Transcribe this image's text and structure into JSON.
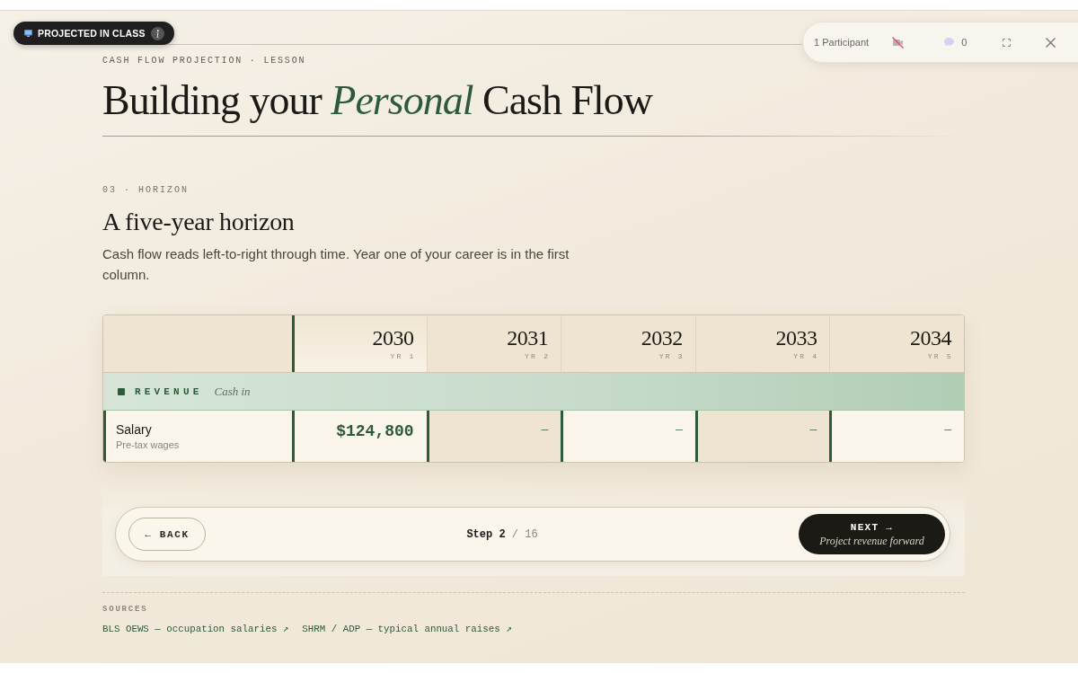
{
  "presentation_badge": {
    "label": "PROJECTED IN CLASS"
  },
  "call_bar": {
    "participants": "1 Participant",
    "video_muted": true,
    "chat_count": "0"
  },
  "lesson": {
    "eyebrow": "CASH FLOW PROJECTION · LESSON",
    "title": "Building your *Personal* Cash Flow"
  },
  "section": {
    "eyebrow": "03 · HORIZON",
    "heading": "A five-year horizon",
    "body": "Cash flow reads left-to-right through time. Year one of your career is in the first column."
  },
  "table": {
    "years": [
      {
        "year": "2030",
        "label": "YR 1",
        "current": true
      },
      {
        "year": "2031",
        "label": "YR 2",
        "current": false
      },
      {
        "year": "2032",
        "label": "YR 3",
        "current": false
      },
      {
        "year": "2033",
        "label": "YR 4",
        "current": false
      },
      {
        "year": "2034",
        "label": "YR 5",
        "current": false
      }
    ],
    "groups": [
      {
        "name": "REVENUE",
        "note": "Cash in",
        "rows": [
          {
            "label": "Salary",
            "sublabel": "Pre-tax wages",
            "cells": [
              {
                "kind": "amount",
                "text": "$124,800"
              },
              {
                "kind": "empty",
                "text": "—"
              },
              {
                "kind": "empty",
                "text": "—"
              },
              {
                "kind": "empty",
                "text": "—"
              },
              {
                "kind": "empty",
                "text": "—"
              }
            ]
          }
        ]
      }
    ]
  },
  "navigation": {
    "back": "← BACK",
    "step": "**Step 2** / 16",
    "next": {
      "label": "NEXT →",
      "hint": "Project revenue forward"
    }
  },
  "sources": {
    "title": "SOURCES",
    "links": [
      "BLS OEWS — occupation salaries ↗",
      "SHRM / ADP — typical annual raises ↗"
    ]
  }
}
